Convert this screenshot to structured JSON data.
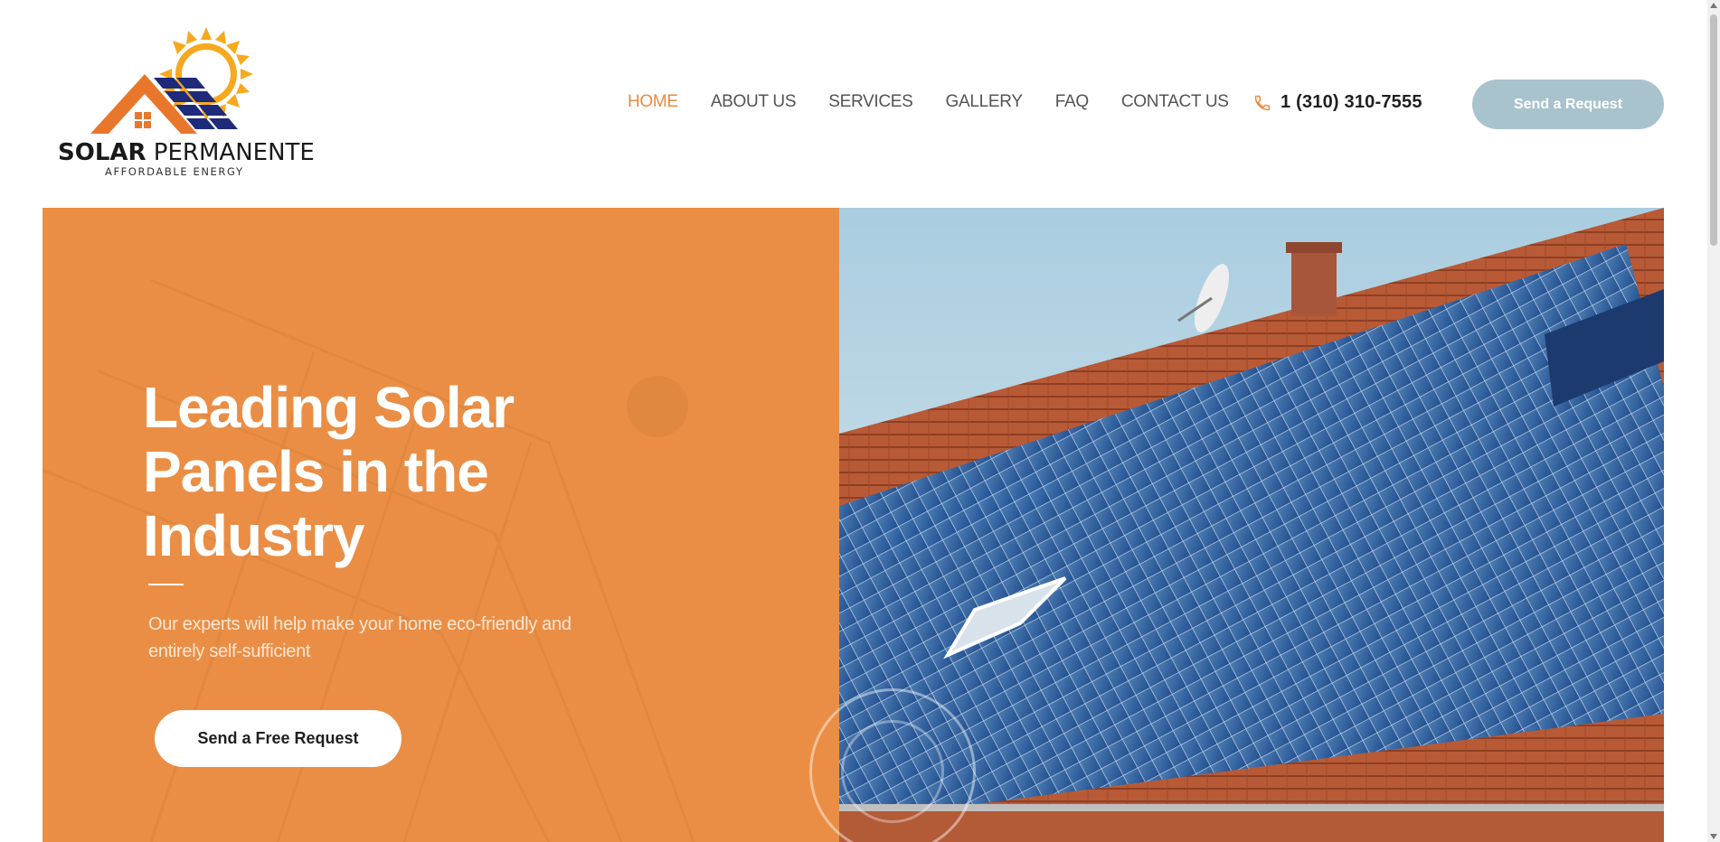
{
  "brand": {
    "name_bold": "SOLAR",
    "name_rest": " PERMANENTE",
    "tagline": "AFFORDABLE  ENERGY",
    "colors": {
      "orange": "#e98a3f",
      "navy": "#1e2a7a",
      "sun": "#f5a623"
    }
  },
  "nav": {
    "items": [
      {
        "label": "HOME",
        "active": true
      },
      {
        "label": "ABOUT US"
      },
      {
        "label": "SERVICES"
      },
      {
        "label": "GALLERY"
      },
      {
        "label": "FAQ"
      },
      {
        "label": "CONTACT US"
      }
    ]
  },
  "phone": {
    "icon": "phone-icon",
    "number": "1 (310) 310-7555"
  },
  "header_button": {
    "label": "Send a Request"
  },
  "hero": {
    "title": "Leading Solar Panels in the Industry",
    "subtitle": "Our experts will help make your home eco-friendly and entirely self-sufficient",
    "cta": "Send a Free Request",
    "slides": {
      "count": 3,
      "active": 1
    },
    "colors": {
      "panel": "#ea8e45"
    }
  }
}
